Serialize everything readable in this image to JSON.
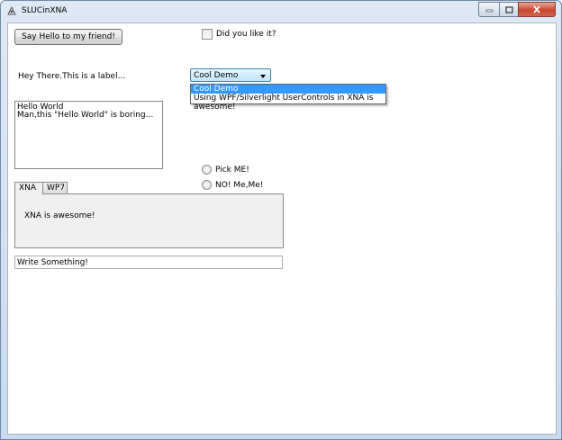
{
  "window": {
    "title": "SLUCinXNA",
    "controls": {
      "minimize_icon": "minimize-icon",
      "maximize_icon": "maximize-icon",
      "close_icon": "close-icon"
    }
  },
  "button": {
    "label": "Say Hello to my friend!"
  },
  "checkbox": {
    "label": "Did you like it?",
    "checked": false
  },
  "label": {
    "text": "Hey There.This is a label..."
  },
  "combobox": {
    "selected": "Cool Demo",
    "options": [
      "Cool Demo",
      "Using WPF/Silverlight UserControls in XNA is awesome!"
    ],
    "highlighted_index": 0
  },
  "textarea": {
    "lines": [
      "Hello World",
      "Man,this \"Hello World\" is boring..."
    ]
  },
  "radios": [
    {
      "label": "Pick ME!",
      "checked": false
    },
    {
      "label": "NO! Me,Me!",
      "checked": false
    }
  ],
  "tabs": {
    "items": [
      {
        "label": "XNA",
        "selected": true
      },
      {
        "label": "WP7",
        "selected": false
      }
    ],
    "content": "XNA is awesome!"
  },
  "textbox": {
    "value": "Write Something!"
  },
  "colors": {
    "selection": "#3399ff",
    "frame": "#c9dbee",
    "close": "#c8452d"
  }
}
